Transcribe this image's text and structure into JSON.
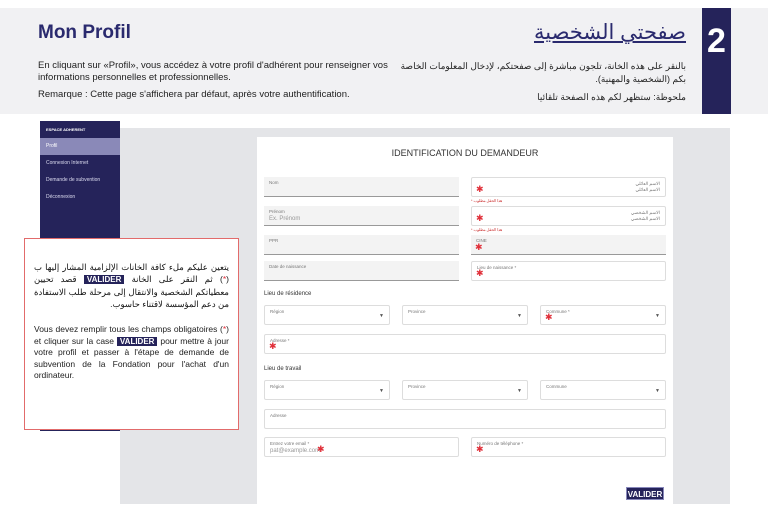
{
  "header": {
    "title_fr": "Mon Profil",
    "intro_fr": "En cliquant sur «Profil», vous accédez à votre profil d'adhérent pour renseigner vos informations personnelles et professionnelles.",
    "note_fr": "Remarque : Cette page s'affichera par défaut, après votre authentification.",
    "title_ar": "صفحتي الشخصية",
    "intro_ar": "بالنقر على هذه الخانة، تلجون مباشرة إلى صفحتكم، لإدخال المعلومات الخاصة بكم (الشخصية والمهنية).",
    "note_ar": "ملحوظة: ستظهر لكم هذه الصفحة تلقائيا",
    "step": "2"
  },
  "sidebar": {
    "heading": "ESPACE ADHERENT",
    "items": [
      {
        "label": "Profil"
      },
      {
        "label": "Connexion Internet"
      },
      {
        "label": "Demande de subvention"
      },
      {
        "label": "Déconnexion"
      }
    ]
  },
  "form": {
    "title": "IDENTIFICATION DU DEMANDEUR",
    "nom": "Nom",
    "prenom": "Prénom",
    "prenom_ph": "Ex. Prénom",
    "ppr": "PPR",
    "date_naissance": "Date de naissance",
    "nom_ar": "الاسم العائلي",
    "prenom_ar": "الاسم الشخصي",
    "required_ar": "هذا الحقل مطلوب *",
    "cine": "CINE",
    "lieu_naissance": "Lieu de naissance *",
    "residence": "Lieu de résidence",
    "travail": "Lieu de travail",
    "region": "Région",
    "province": "Province",
    "commune_req": "Commune *",
    "commune": "Commune",
    "adresse_req": "Adresse *",
    "adresse": "Adresse",
    "email": "Entrez votre email *",
    "email_ph": "pat@example.com",
    "telephone": "Numéro de téléphone *",
    "valider": "VALIDER"
  },
  "callout": {
    "ar_1": "يتعين عليكم ملء كافة الخانات الإلزامية المشار إليها ب (",
    "star": "*",
    "ar_2": ") ثم النقر على الخانة",
    "ar_3": "قصد تحيين معطياتكم الشخصية والانتقال إلى مرحلة طلب الاستفادة من دعم المؤسسة لاقتناء حاسوب.",
    "fr_1": "Vous devez remplir tous les champs obligatoires (",
    "fr_2": ") et cliquer sur la case",
    "fr_3": "pour mettre à jour votre profil et passer à l'étape de demande de subvention de la Fondation pour l'achat d'un ordinateur.",
    "tag": "VALIDER"
  }
}
